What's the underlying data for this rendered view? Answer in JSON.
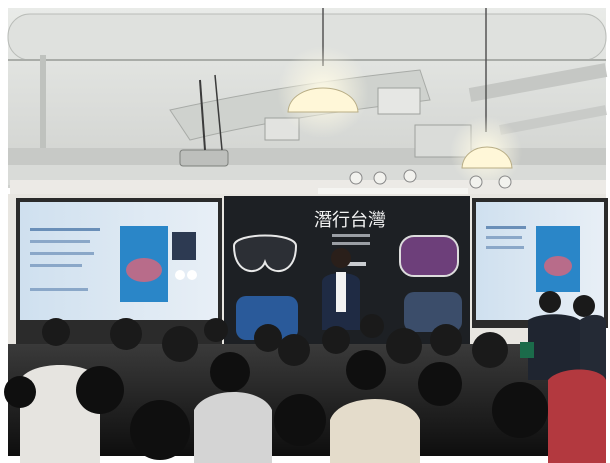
{
  "scene": {
    "backdrop_title": "潛行台灣",
    "colors": {
      "ceiling": "#d9dbd8",
      "wall": "#e8e6e1",
      "backdrop": "#1d2024",
      "screen_glow": "#d8e6f2",
      "screen_blue": "#2a86c8",
      "audience_dark": "#141414"
    }
  }
}
